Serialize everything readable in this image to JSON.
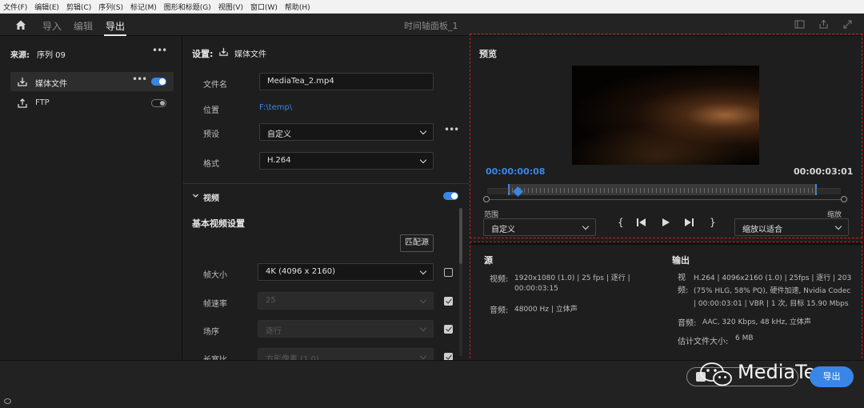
{
  "menu": [
    "文件(F)",
    "编辑(E)",
    "剪辑(C)",
    "序列(S)",
    "标记(M)",
    "图形和标题(G)",
    "视图(V)",
    "窗口(W)",
    "帮助(H)"
  ],
  "tabs": {
    "import": "导入",
    "edit": "编辑",
    "export": "导出"
  },
  "window_title": "时间轴面板_1",
  "left": {
    "source_label": "来源:",
    "source_value": "序列 09",
    "items": [
      {
        "label": "媒体文件",
        "enabled": true
      },
      {
        "label": "FTP",
        "enabled": false
      }
    ]
  },
  "settings": {
    "title": "设置:",
    "media_label": "媒体文件",
    "filename_label": "文件名",
    "filename_value": "MediaTea_2.mp4",
    "location_label": "位置",
    "location_value": "F:\\temp\\",
    "preset_label": "预设",
    "preset_value": "自定义",
    "format_label": "格式",
    "format_value": "H.264",
    "video_section": "视频",
    "basic_video": "基本视频设置",
    "match_source": "匹配源",
    "frame_size_label": "帧大小",
    "frame_size_value": "4K (4096 x 2160)",
    "frame_rate_label": "帧速率",
    "frame_rate_value": "25",
    "field_order_label": "场序",
    "field_order_value": "逐行",
    "aspect_label": "长宽比",
    "aspect_value": "方形像素 (1.0)"
  },
  "preview": {
    "title": "预览",
    "tc_current": "00:00:00:08",
    "tc_total": "00:00:03:01",
    "range_label": "范围",
    "range_value": "自定义",
    "scale_label": "缩放",
    "scale_value": "缩放以适合",
    "playhead_fraction": 0.03
  },
  "summary": {
    "source_title": "源",
    "video_label": "视频:",
    "video_line1": "1920x1080 (1.0) | 25 fps | 逐行 |",
    "video_line2": "00:00:03:15",
    "audio_label": "音频:",
    "audio_value": "48000 Hz | 立体声",
    "output_title": "输出",
    "out_video_label": "视频:",
    "out_video_line1": "H.264 | 4096x2160 (1.0) | 25fps | 逐行 | 203",
    "out_video_line2": "(75% HLG, 58% PQ), 硬件加速, Nvidia Codec",
    "out_video_line3": "| 00:00:03:01 | VBR | 1 次, 目标 15.90 Mbps",
    "out_audio_label": "音频:",
    "out_audio_value": "AAC, 320 Kbps, 48 kHz, 立体声",
    "est_label": "估计文件大小:",
    "est_value": "6 MB"
  },
  "footer": {
    "watermark": "MediaTea",
    "export_label": "导出"
  },
  "colors": {
    "accent": "#3a86e8",
    "highlight": "#d21e1e"
  }
}
